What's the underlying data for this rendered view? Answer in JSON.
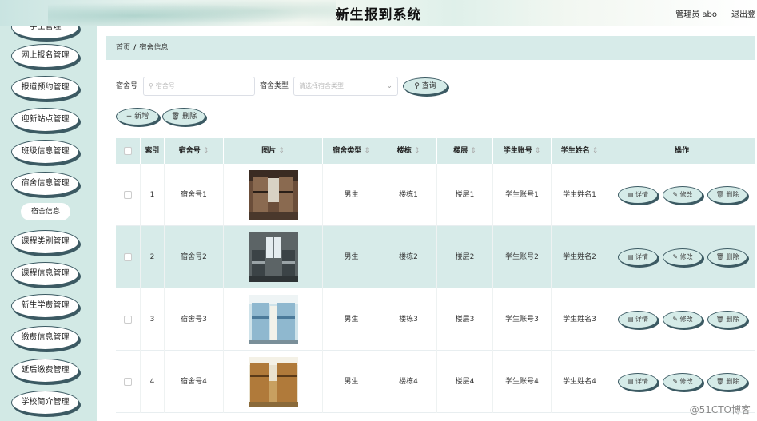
{
  "header": {
    "title": "新生报到系统",
    "user": "管理员 abo",
    "logout": "退出登"
  },
  "sidebar": {
    "items": [
      {
        "label": "学生管理"
      },
      {
        "label": "网上报名管理"
      },
      {
        "label": "报道预约管理"
      },
      {
        "label": "迎新站点管理"
      },
      {
        "label": "班级信息管理"
      },
      {
        "label": "宿舍信息管理"
      },
      {
        "label": "宿舍信息"
      },
      {
        "label": "课程类别管理"
      },
      {
        "label": "课程信息管理"
      },
      {
        "label": "新生学费管理"
      },
      {
        "label": "缴费信息管理"
      },
      {
        "label": "延后缴费管理"
      },
      {
        "label": "学校简介管理"
      }
    ]
  },
  "breadcrumb": {
    "home": "首页",
    "separator": "/",
    "current": "宿舍信息"
  },
  "search": {
    "room_label": "宿舍号",
    "room_placeholder": "宿舍号",
    "type_label": "宿舍类型",
    "type_placeholder": "请选择宿舍类型",
    "query_button": "查询"
  },
  "actions": {
    "add": "新增",
    "delete": "删除"
  },
  "table": {
    "columns": [
      "索引",
      "宿舍号",
      "图片",
      "宿舍类型",
      "楼栋",
      "楼层",
      "学生账号",
      "学生姓名",
      "操作"
    ],
    "rows": [
      {
        "index": "1",
        "room": "宿舍号1",
        "type": "男生",
        "building": "楼栋1",
        "floor": "楼层1",
        "account": "学生账号1",
        "name": "学生姓名1"
      },
      {
        "index": "2",
        "room": "宿舍号2",
        "type": "男生",
        "building": "楼栋2",
        "floor": "楼层2",
        "account": "学生账号2",
        "name": "学生姓名2"
      },
      {
        "index": "3",
        "room": "宿舍号3",
        "type": "男生",
        "building": "楼栋3",
        "floor": "楼层3",
        "account": "学生账号3",
        "name": "学生姓名3"
      },
      {
        "index": "4",
        "room": "宿舍号4",
        "type": "男生",
        "building": "楼栋4",
        "floor": "楼层4",
        "account": "学生账号4",
        "name": "学生姓名4"
      }
    ],
    "op_detail": "详情",
    "op_edit": "修改",
    "op_delete": "删除"
  },
  "watermark": "@51CTO博客",
  "icons": {
    "search": "search-icon",
    "plus": "plus-icon",
    "trash": "trash-icon",
    "detail": "document-icon",
    "edit": "pencil-icon",
    "sort": "sort-icon",
    "dropdown": "chevron-down-icon"
  },
  "colors": {
    "sidebar_bg": "#d2e9e5",
    "accent_bg": "#d7ebe9",
    "button_border": "#3c5a63"
  }
}
